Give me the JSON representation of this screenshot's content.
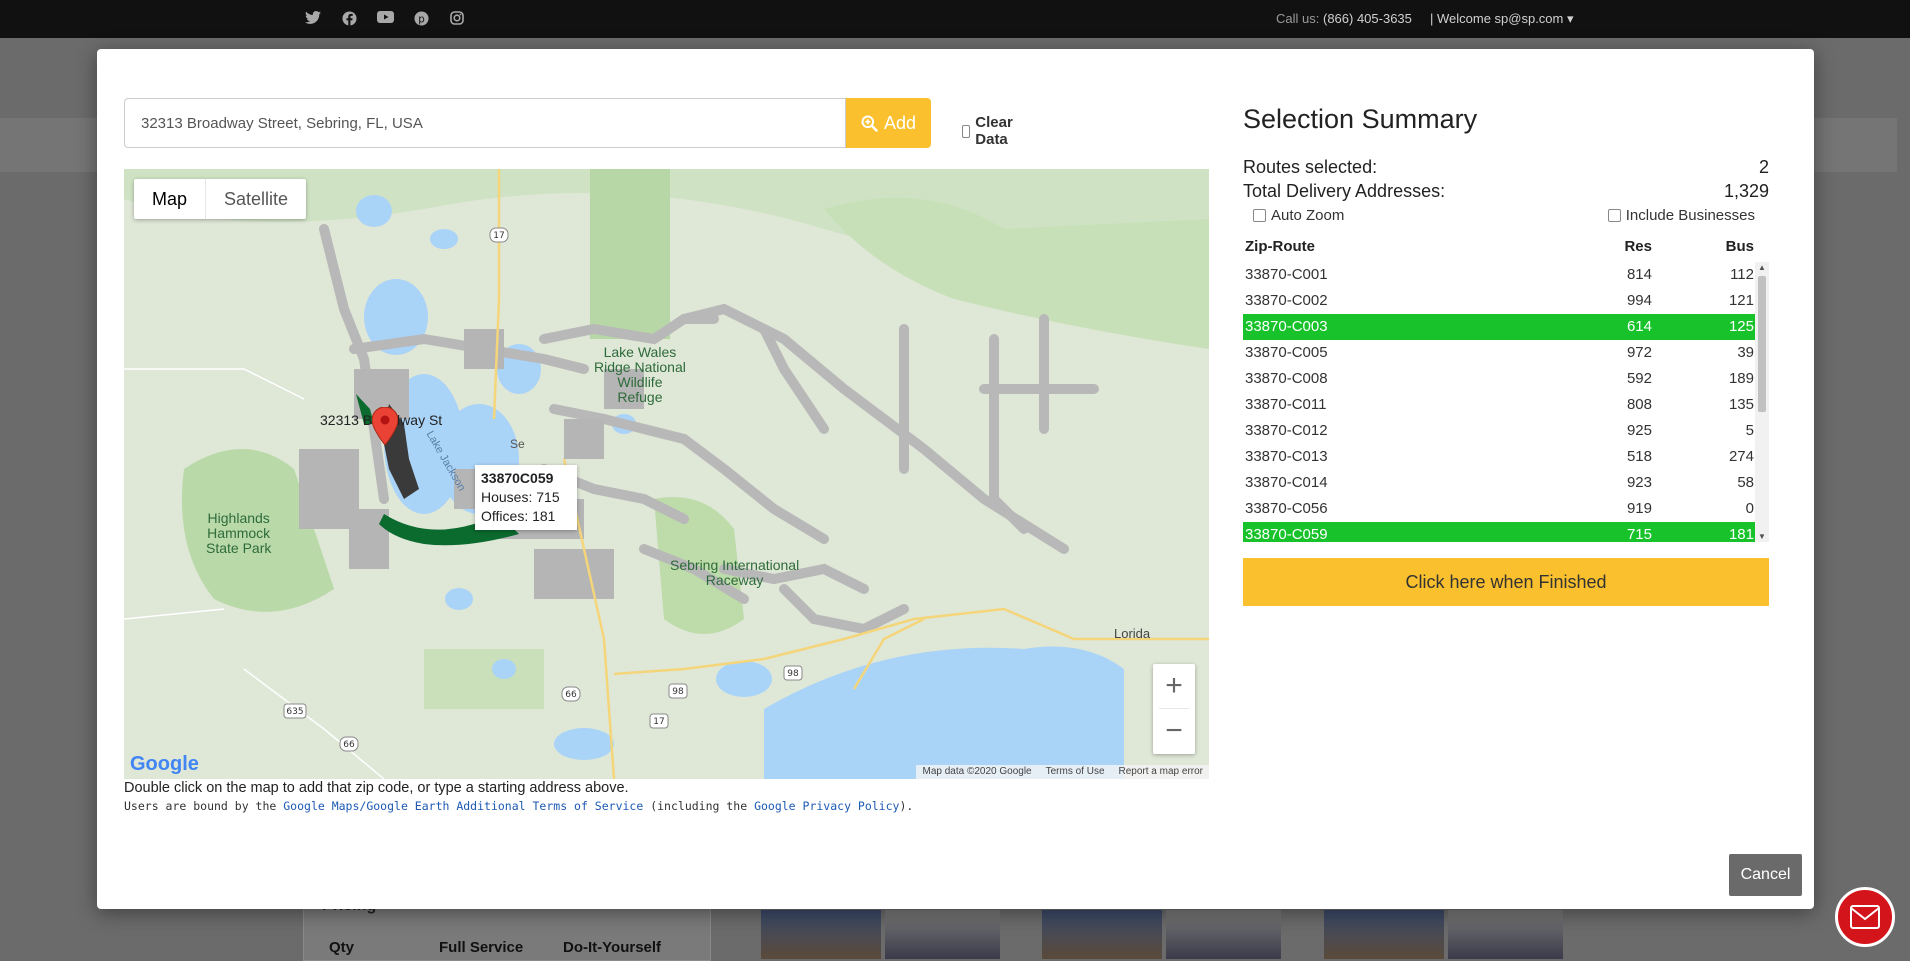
{
  "header": {
    "social_icons": [
      "twitter-icon",
      "facebook-icon",
      "youtube-icon",
      "pinterest-icon",
      "instagram-icon"
    ],
    "call_label": "Call us:",
    "phone": "(866) 405-3635",
    "welcome": "| Welcome  sp@sp.com ▾"
  },
  "background": {
    "pricing_title": "Pricing",
    "columns": [
      "Qty",
      "Full Service",
      "Do-It-Yourself"
    ]
  },
  "search": {
    "value": "32313 Broadway Street, Sebring, FL, USA",
    "add_label": "Add",
    "clear_label": "Clear Data"
  },
  "map": {
    "type_map": "Map",
    "type_satellite": "Satellite",
    "marker_label": "32313 Broadway St",
    "info": {
      "title": "33870C059",
      "houses": "Houses: 715",
      "offices": "Offices: 181"
    },
    "places": {
      "highlands": "Highlands\nHammock\nState Park",
      "refuge": "Lake Wales\nRidge National\nWildlife\nRefuge",
      "raceway": "Sebring International\nRaceway",
      "lorida": "Lorida",
      "lake": "Lake Jackson",
      "se": "Se"
    },
    "road_labels": [
      "17",
      "98",
      "98",
      "66",
      "17",
      "635",
      "66"
    ],
    "zoom_in": "+",
    "zoom_out": "−",
    "logo": "Google",
    "footer": [
      "Map data ©2020 Google",
      "Terms of Use",
      "Report a map error"
    ]
  },
  "notes": {
    "instruction": "Double click on the map to add that zip code, or type a starting address above.",
    "terms_prefix": "Users are bound by the ",
    "terms_link1": "Google Maps/Google Earth Additional Terms of Service",
    "terms_mid": " (including the ",
    "terms_link2": "Google Privacy Policy",
    "terms_suffix": ")."
  },
  "summary": {
    "title": "Selection Summary",
    "routes_label": "Routes selected:",
    "routes_value": "2",
    "addresses_label": "Total Delivery Addresses:",
    "addresses_value": "1,329",
    "auto_zoom": "Auto Zoom",
    "include_businesses": "Include Businesses",
    "col_zip": "Zip-Route",
    "col_res": "Res",
    "col_bus": "Bus",
    "rows": [
      {
        "zip": "33870-C001",
        "res": "814",
        "bus": "112",
        "selected": false
      },
      {
        "zip": "33870-C002",
        "res": "994",
        "bus": "121",
        "selected": false
      },
      {
        "zip": "33870-C003",
        "res": "614",
        "bus": "125",
        "selected": true
      },
      {
        "zip": "33870-C005",
        "res": "972",
        "bus": "39",
        "selected": false
      },
      {
        "zip": "33870-C008",
        "res": "592",
        "bus": "189",
        "selected": false
      },
      {
        "zip": "33870-C011",
        "res": "808",
        "bus": "135",
        "selected": false
      },
      {
        "zip": "33870-C012",
        "res": "925",
        "bus": "5",
        "selected": false
      },
      {
        "zip": "33870-C013",
        "res": "518",
        "bus": "274",
        "selected": false
      },
      {
        "zip": "33870-C014",
        "res": "923",
        "bus": "58",
        "selected": false
      },
      {
        "zip": "33870-C056",
        "res": "919",
        "bus": "0",
        "selected": false
      },
      {
        "zip": "33870-C059",
        "res": "715",
        "bus": "181",
        "selected": true
      }
    ],
    "finish_label": "Click here when Finished",
    "selected_color": "#18c22b",
    "accent_color": "#fbc02d"
  },
  "cancel_label": "Cancel"
}
